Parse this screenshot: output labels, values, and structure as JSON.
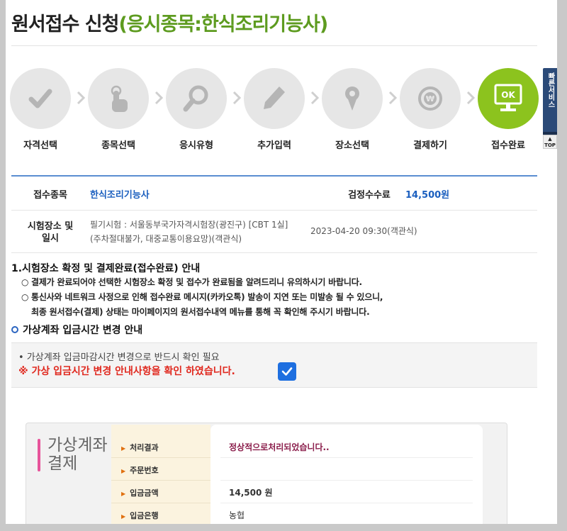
{
  "header": {
    "title": "원서접수 신청",
    "subtitle": "(응시종목:한식조리기능사)"
  },
  "steps": [
    {
      "label": "자격선택",
      "icon": "check-icon",
      "active": false
    },
    {
      "label": "종목선택",
      "icon": "touch-icon",
      "active": false
    },
    {
      "label": "응시유형",
      "icon": "magnifier-icon",
      "active": false
    },
    {
      "label": "추가입력",
      "icon": "pencil-icon",
      "active": false
    },
    {
      "label": "장소선택",
      "icon": "location-pin-icon",
      "active": false
    },
    {
      "label": "결제하기",
      "icon": "won-coin-icon",
      "active": false
    },
    {
      "label": "접수완료",
      "icon": "ok-monitor-icon",
      "active": true,
      "badge": "OK"
    }
  ],
  "info": {
    "item_label": "접수종목",
    "item_value": "한식조리기능사",
    "fee_label": "검정수수료",
    "fee_value": "14,500원",
    "place_label_1": "시험장소 및",
    "place_label_2": "일시",
    "place_value_1": "필기시험 : 서울동부국가자격시험장(광진구) [CBT 1실]",
    "place_value_2": "(주차절대불가, 대중교통이용요망)(객관식)",
    "datetime": "2023-04-20 09:30(객관식)"
  },
  "notice": {
    "heading": "1.시험장소 확정 및 결제완료(접수완료) 안내",
    "bullet": "○",
    "items": [
      "결제가 완료되어야 선택한 시험장소 확정 및 접수가 완료됨을 알려드리니 유의하시기 바랍니다.",
      "통신사와 네트워크 사정으로 인해 접수완료 메시지(카카오톡) 발송이 지연 또는 미발송 될 수 있으니,",
      "최종 원서접수(결제) 상태는 마이페이지의 원서접수내역 메뉴를 통해 꼭 확인해 주시기 바랍니다."
    ]
  },
  "virtual": {
    "heading": "가상계좌 입금시간 변경 안내",
    "line1": "• 가상계좌 입금마감시간 변경으로 반드시 확인 필요",
    "line2": "※ 가상 입금시간 변경 안내사항을 확인 하였습니다.",
    "checked": true
  },
  "payment": {
    "title_1": "가상계좌",
    "title_2": "결제",
    "rows": [
      {
        "label": "처리결과",
        "value": "정상적으로처리되었습니다.."
      },
      {
        "label": "주문번호",
        "value": ""
      },
      {
        "label": "입금금액",
        "value": "14,500 원"
      },
      {
        "label": "입금은행",
        "value": "농협"
      }
    ]
  },
  "side": {
    "quick_service": "빠른서비스",
    "arrow": "<",
    "top_1": "▲",
    "top_2": "TOP"
  },
  "colors": {
    "subtitle": "#5d9b1f",
    "active_step": "#8cc31e",
    "blue_value": "#1b5fbf",
    "warning_red": "#e0281e",
    "checkbox": "#1e6fe0"
  }
}
